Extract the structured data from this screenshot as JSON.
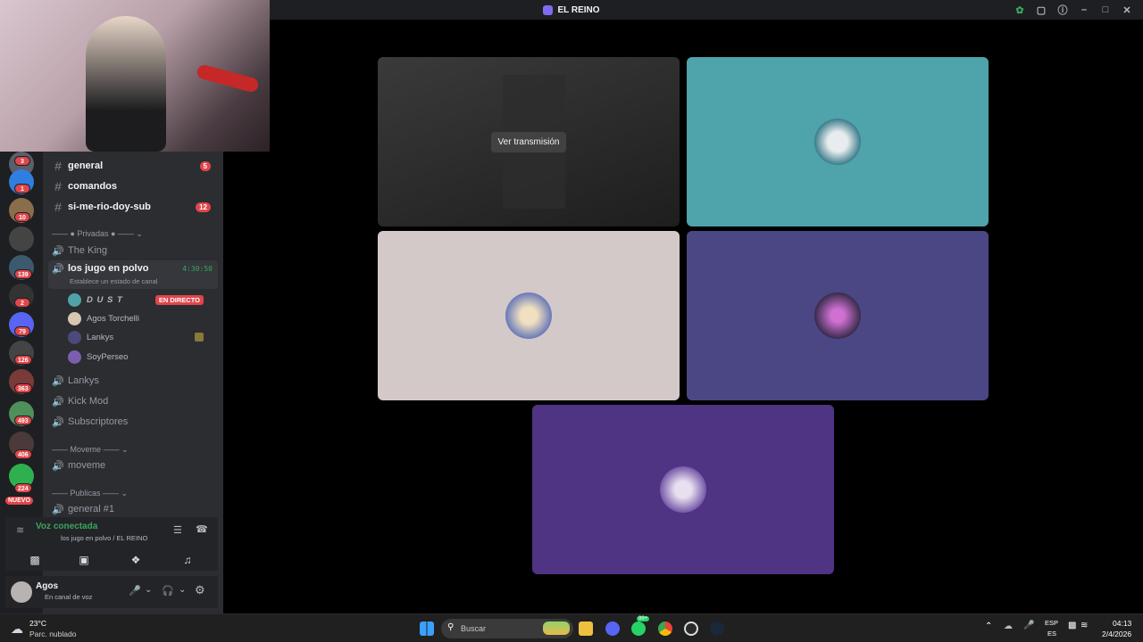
{
  "window": {
    "title": "EL REINO"
  },
  "channels": [
    {
      "label": "general",
      "badge": "5"
    },
    {
      "label": "comandos",
      "badge": ""
    },
    {
      "label": "si-me-rio-doy-sub",
      "badge": "12"
    }
  ],
  "categories": {
    "privadas": "Privadas",
    "moveme": "Moveme",
    "publicas": "Publicas"
  },
  "voice_channels": {
    "the_king": "The King",
    "active": "los jugo en polvo",
    "active_timer": "4:30:50",
    "active_status": "Establece un estado de canal",
    "lankys": "Lankys",
    "kick_mod": "Kick Mod",
    "subscriptores": "Subscriptores",
    "moveme": "moveme",
    "general1": "general #1"
  },
  "members": [
    {
      "name": "D U S T",
      "live": "EN DIRECTO",
      "color": "#4fa3a8"
    },
    {
      "name": "Agos Torchelli",
      "live": "",
      "color": "#d8c7b0"
    },
    {
      "name": "Lankys",
      "live": "",
      "color": "#4b4a7a"
    },
    {
      "name": "SoyPerseo",
      "live": "",
      "color": "#7a5fb0"
    }
  ],
  "server_badges": [
    "3",
    "1",
    "10",
    "139",
    "2",
    "79",
    "126",
    "363",
    "493",
    "406",
    "224"
  ],
  "server_nuevo": "NUEVO",
  "voice_panel": {
    "status": "Voz conectada",
    "location": "los jugo en polvo / EL REINO"
  },
  "user_panel": {
    "name": "Agos",
    "status": "En canal de voz"
  },
  "stage": {
    "stream_button": "Ver transmisión",
    "tile_colors": [
      "#2a2a2a",
      "#4fa3ab",
      "#d4c9c9",
      "#4b4784",
      "#4f3483"
    ]
  },
  "taskbar": {
    "weather_temp": "23°C",
    "weather_desc": "Parc. nublado",
    "search_placeholder": "Buscar",
    "lang_top": "ESP",
    "lang_bottom": "ES",
    "time": "04:13",
    "date": "2/4/2026",
    "whatsapp_badge": "99+"
  }
}
